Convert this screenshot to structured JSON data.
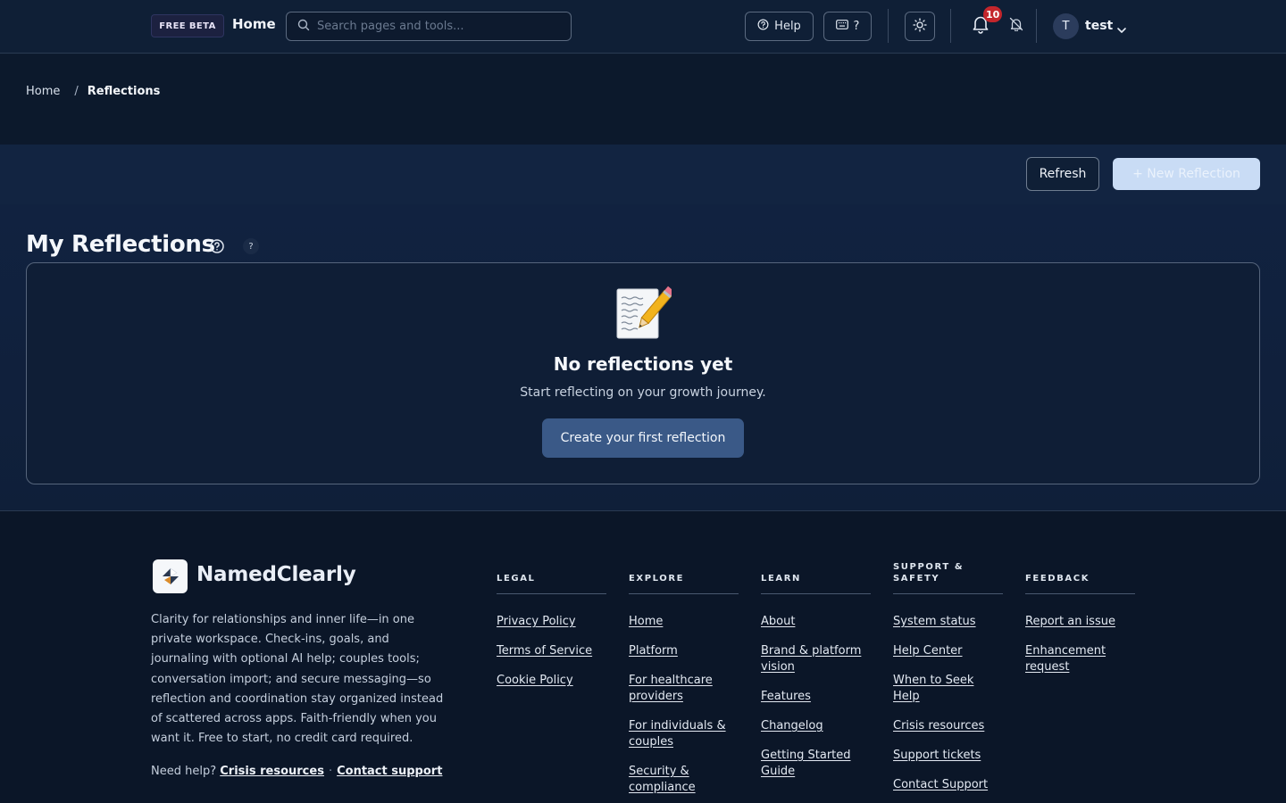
{
  "header": {
    "beta_badge": "FREE BETA",
    "home_label": "Home",
    "search_placeholder": "Search pages and tools...",
    "help_label": "Help",
    "shortcuts_label": "?",
    "notification_count": "10",
    "user_initial": "T",
    "user_name": "test"
  },
  "breadcrumb": {
    "home": "Home",
    "separator": "/",
    "current": "Reflections"
  },
  "actions": {
    "refresh_label": "Refresh",
    "new_label": "+ New Reflection"
  },
  "main": {
    "title": "My Reflections",
    "info_label": "?",
    "empty_icon": "memo-icon",
    "empty_title": "No reflections yet",
    "empty_subtitle": "Start reflecting on your growth journey.",
    "create_label": "Create your first reflection"
  },
  "footer": {
    "brand": "NamedClearly",
    "blurb": "Clarity for relationships and inner life—in one private workspace. Check-ins, goals, and journaling with optional AI help; couples tools; conversation import; and secure messaging—so reflection and coordination stay organized instead of scattered across apps. Faith-friendly when you want it. Free to start, no credit card required.",
    "need_help_prefix": "Need help?",
    "crisis_link": "Crisis resources",
    "dot": "·",
    "contact_link": "Contact support",
    "columns": [
      {
        "title": "LEGAL",
        "links": [
          "Privacy Policy",
          "Terms of Service",
          "Cookie Policy"
        ]
      },
      {
        "title": "EXPLORE",
        "links": [
          "Home",
          "Platform",
          "For healthcare providers",
          "For individuals & couples",
          "Security & compliance"
        ]
      },
      {
        "title": "LEARN",
        "links": [
          "About",
          "Brand & platform vision",
          "Features",
          "Changelog",
          "Getting Started Guide"
        ]
      },
      {
        "title": "SUPPORT & SAFETY",
        "links": [
          "System status",
          "Help Center",
          "When to Seek Help",
          "Crisis resources",
          "Support tickets",
          "Contact Support"
        ]
      },
      {
        "title": "FEEDBACK",
        "links": [
          "Report an issue",
          "Enhancement request"
        ]
      }
    ]
  },
  "colors": {
    "background": "#0d1b30",
    "accent_button": "#3a5987",
    "disabled_button": "#c9dcf5",
    "badge": "#c4262c"
  }
}
